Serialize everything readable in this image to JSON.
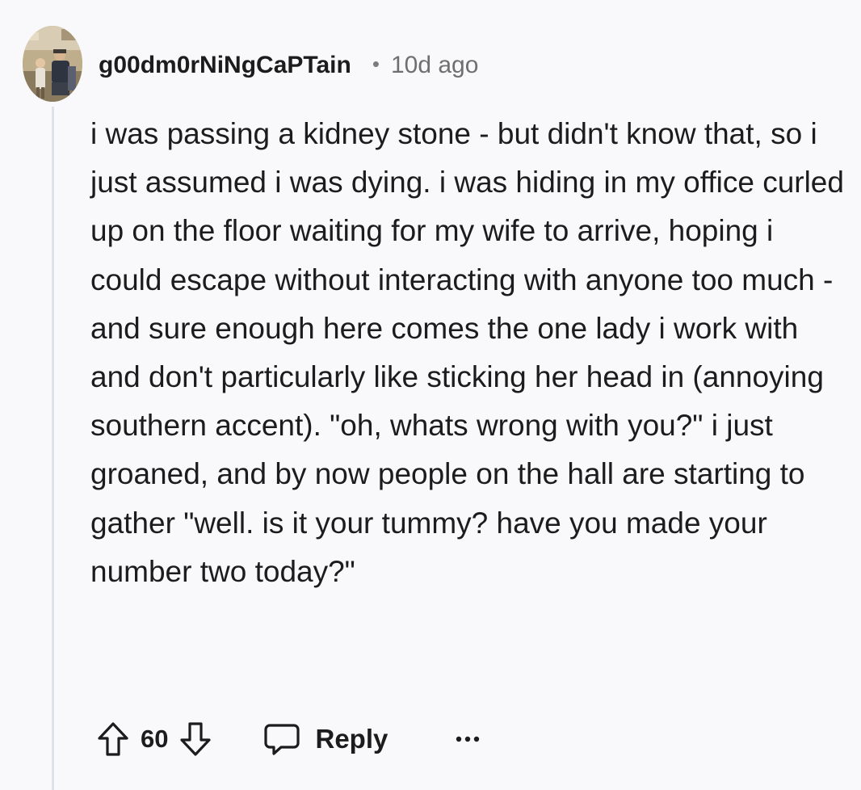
{
  "comment": {
    "username": "g00dm0rNiNgCaPTain",
    "separator": "•",
    "timestamp": "10d ago",
    "body": "i was passing a kidney stone - but didn't know that, so i just assumed i was dying. i was hiding in my office curled up on the floor waiting for my wife to arrive, hoping i could escape without interacting with anyone too much - and sure enough here comes the one lady i work with and don't particularly like sticking her head in (annoying southern accent). \"oh, whats wrong with you?\" i just groaned, and by now people on the hall are starting to gather \"well. is it your tummy? have you made your number two today?\"",
    "score": "60",
    "reply_label": "Reply"
  },
  "icons": {
    "upvote": "arrow-up-outline-icon",
    "downvote": "arrow-down-outline-icon",
    "reply": "speech-bubble-icon",
    "more": "ellipsis-horizontal-icon"
  }
}
